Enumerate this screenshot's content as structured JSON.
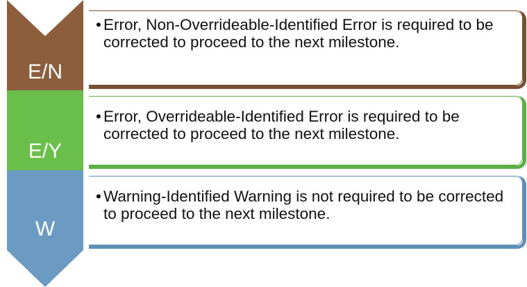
{
  "steps": [
    {
      "code": "E/N",
      "description": "Error, Non-Overrideable-Identified Error is required to be corrected to proceed to the next milestone.",
      "color": "#8c5e3c",
      "border_color": "#7a5035"
    },
    {
      "code": "E/Y",
      "description": "Error, Overrideable-Identified Error is required to be corrected to proceed to the next milestone.",
      "color": "#6abf4b",
      "border_color": "#5eae46"
    },
    {
      "code": "W",
      "description": "Warning-Identified Warning is not required to be corrected to proceed to the next milestone.",
      "color": "#6b9bc3",
      "border_color": "#5e8fb5"
    }
  ],
  "bullet": "•"
}
